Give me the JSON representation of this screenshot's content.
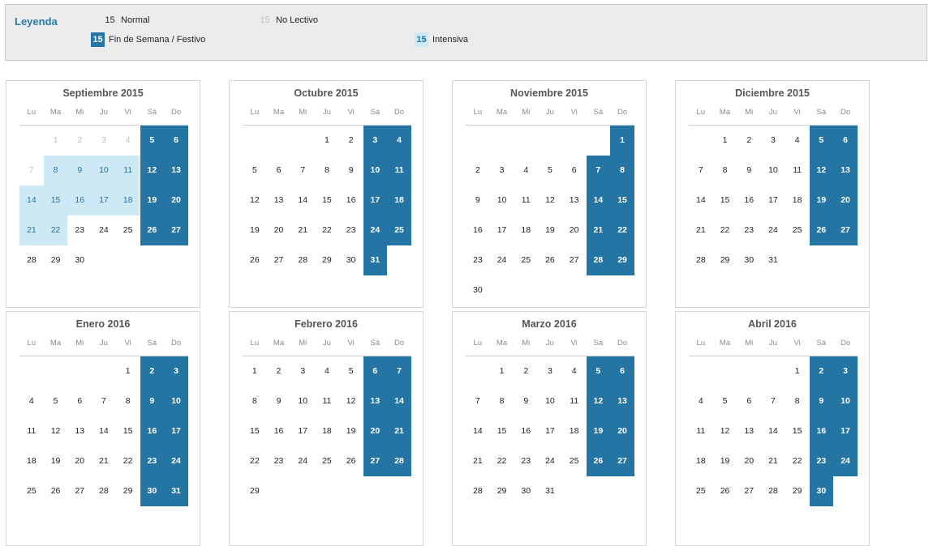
{
  "legend": {
    "title": "Leyenda",
    "items": [
      {
        "sample": "15",
        "label": "Normal",
        "kind": "normal"
      },
      {
        "sample": "15",
        "label": "No Lectivo",
        "kind": "nolect"
      },
      {
        "sample": "15",
        "label": "Fin de Semana / Festivo",
        "kind": "finde"
      },
      {
        "sample": "15",
        "label": "Intensiva",
        "kind": "int"
      }
    ]
  },
  "colors": {
    "festivo": "#2474a4",
    "intensiva": "#cde9f5",
    "nolectivo": "#c2c2c2"
  },
  "weekdays": [
    "Lu",
    "Ma",
    "Mi",
    "Ju",
    "Vi",
    "Sá",
    "Do"
  ],
  "months": [
    {
      "title": "Septiembre 2015",
      "startWeekday": 1,
      "days": 30,
      "nolectivo": [
        1,
        2,
        3,
        4,
        7
      ],
      "intensiva": [
        8,
        9,
        10,
        11,
        14,
        15,
        16,
        17,
        18,
        21,
        22
      ],
      "festivo": []
    },
    {
      "title": "Octubre 2015",
      "startWeekday": 3,
      "days": 31,
      "nolectivo": [],
      "intensiva": [],
      "festivo": []
    },
    {
      "title": "Noviembre 2015",
      "startWeekday": 6,
      "days": 30,
      "nolectivo": [],
      "intensiva": [],
      "festivo": []
    },
    {
      "title": "Diciembre 2015",
      "startWeekday": 1,
      "days": 31,
      "nolectivo": [],
      "intensiva": [],
      "festivo": []
    },
    {
      "title": "Enero 2016",
      "startWeekday": 4,
      "days": 31,
      "nolectivo": [],
      "intensiva": [],
      "festivo": []
    },
    {
      "title": "Febrero 2016",
      "startWeekday": 0,
      "days": 29,
      "nolectivo": [],
      "intensiva": [],
      "festivo": []
    },
    {
      "title": "Marzo 2016",
      "startWeekday": 1,
      "days": 31,
      "nolectivo": [],
      "intensiva": [],
      "festivo": []
    },
    {
      "title": "Abril 2016",
      "startWeekday": 4,
      "days": 30,
      "nolectivo": [],
      "intensiva": [],
      "festivo": []
    }
  ]
}
